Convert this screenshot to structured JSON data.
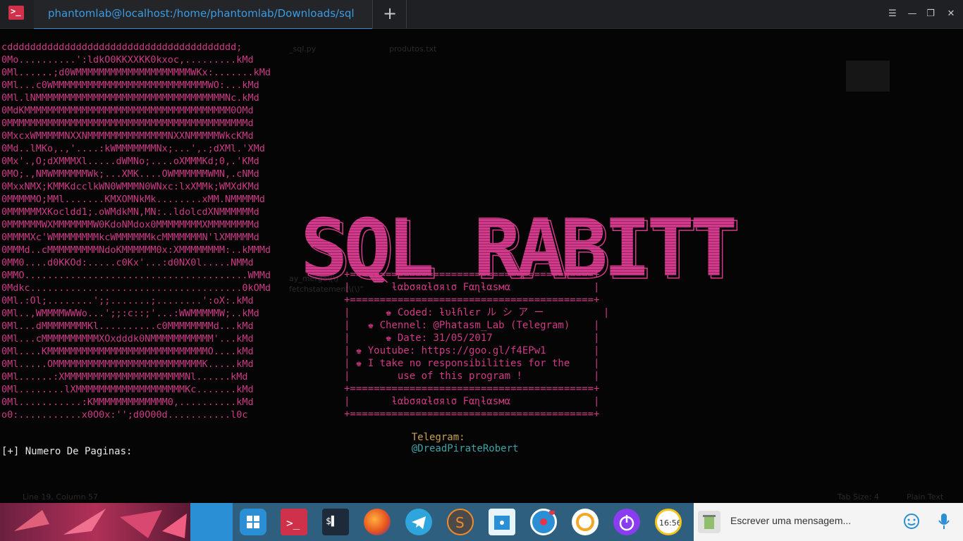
{
  "window": {
    "tab_title": "phantomlab@localhost:/home/phantomlab/Downloads/sql",
    "new_tab": "+",
    "menu": "☰",
    "minimize": "—",
    "maximize": "❐",
    "close": "✕"
  },
  "terminal": {
    "ascii_art": "cdddddddddddddddddddddddddddddddddddddddd;\n0Mo..........':ldkO0KKXXKK0kxoc,.........kMd\n0Ml......;d0WMMMMMMMMMMMMMMMMMMMMWKx:.......kMd\n0Ml...c0WMMMMMMMMMMMMMMMMMMMMMMMMMMMWO:...kMd\n0Ml.lNMMMMMMMMMMMMMMMMMMMMMMMMMMMMMMMMMNc.kMd\n0MdKMMMMMMMMMMMMMMMMMMMMMMMMMMMMMMMMMMMM0OMd\n0MMMMMMMMMMMMMMMMMMMMMMMMMMMMMMMMMMMMMMMMMMd\n0MxcxWMMMMMNXXNMMMMMMMMMMMMMMNXXNMMMMMWkcKMd\n0Md..lMKo,.,'....:kWMMMMMMMNx;...',.;dXMl.'XMd\n0Mx'.,O;dXMMMXl.....dWMNo;....oXMMMKd;0,.'KMd\n0MO;.,NMWMMMMMMWk;...XMK....OWMMMMMMWMN,.cNMd\n0MxxNMX;KMMKdcclkWN0WMMMN0WNxc:lxXMMk;WMXdKMd\n0MMMMMO;MMl.......KMXOMNkMk........xMM.NMMMMMd\n0MMMMMMXKocldd1;.oWMdkMN,MN:..ldolcdXNMMMMMMd\n0MMMMMMWXMMMMMMMW0KdoNMdox0MMMMMMMMXMMMMMMMMd\n0MMMMXc'WMMMMMMMMkcWMMMMMMkcMMMMMMMN'lXMMMMMd\n0MMMd..cMMMMMMMMMNdoKMMMMMM0x:XMMMMMMMM:..kMMMd\n0MM0....d0KKOd:.....c0Kx'...:d0NX0l.....NMMd\n0MMO.......................................WMMd\n0Mdkc.....................................0kOMd\n0Ml.:Ol;........';;.......;........':oX:.kMd\n0Ml..,WMMMMWWWo...';;:c::;'...:WWMMMMMW;..kMd\n0Ml...dMMMMMMMMKl..........c0MMMMMMMMd...kMd\n0Ml...cMMMMMMMMMMXOxdddk0NMMMMMMMMMMM'...kMd\n0Ml....KMMMMMMMMMMMMMMMMMMMMMMMMMMMMO....kMd\n0Ml.....OMMMMMMMMMMMMMMMMMMMMMMMMMMK.....kMd\n0Ml......:XMMMMMMMMMMMMMMMMMMMMMNl......kMd\n0Ml........lXMMMMMMMMMMMMMMMMMMMKc.......kMd\n0Ml...........:KMMMMMMMMMMMMM0,..........kMd\no0:...........x0O0x:'';d0O00d...........l0c",
    "banner_text": "SQL RABITT",
    "box": "+=========================================+\n|       ƚαbσяαƚσяισ Fαɳƚαѕмα              |\n+=========================================+\n|      ♚ Coded: ƚυƚɦlєr ル シ ア ー          |\n|   ♚ Chennel: @Phatasm_Lab (Telegram)    |\n|      ♚ Date: 31/05/2017                 |\n| ♚ Youtube: https://goo.gl/f4EPw1        |\n| ♚ I take no responsibilities for the    |\n|        use of this program !            |\n+=========================================+\n|       ƚαbσяαƚσяισ Fαɳƚαѕмα              |\n+=========================================+",
    "telegram_label": "Telegram:",
    "telegram_handle": "@DreadPirateRobert",
    "prompt": "[+] Numero De Paginas: "
  },
  "background_editor": {
    "tab1": "_sql.py",
    "tab2": "produtos.txt",
    "status_left": "Line 19, Column 57",
    "status_tab": "Tab Size: 4",
    "status_syntax": "Plain Text",
    "snippet1": "ay_merge\\(\\)",
    "snippet2": "fetchstatement\\(\\)\""
  },
  "taskbar": {
    "chat_placeholder": "Escrever uma mensagem...",
    "clock": "16:56"
  },
  "colors": {
    "accent": "#2a8fd4",
    "ascii_pink": "#cf3a86",
    "telegram_gold": "#c9a24a",
    "telegram_teal": "#3ba3a8"
  }
}
